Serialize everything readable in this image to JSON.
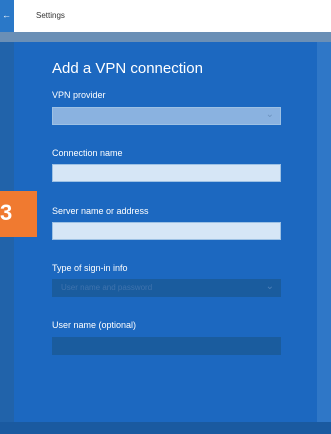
{
  "window": {
    "title": "Settings",
    "back_icon": "back-arrow-icon"
  },
  "dialog": {
    "heading": "Add a VPN connection",
    "fields": [
      {
        "label": "VPN provider",
        "value": ""
      },
      {
        "label": "Connection name",
        "value": ""
      },
      {
        "label": "Server name or address",
        "value": ""
      },
      {
        "label": "Type of sign-in info",
        "value": "User name and password"
      },
      {
        "label": "User name (optional)",
        "value": ""
      }
    ]
  },
  "badge": {
    "text": "3"
  },
  "colors": {
    "background": "#1e66b8",
    "accent": "#f07a30"
  }
}
